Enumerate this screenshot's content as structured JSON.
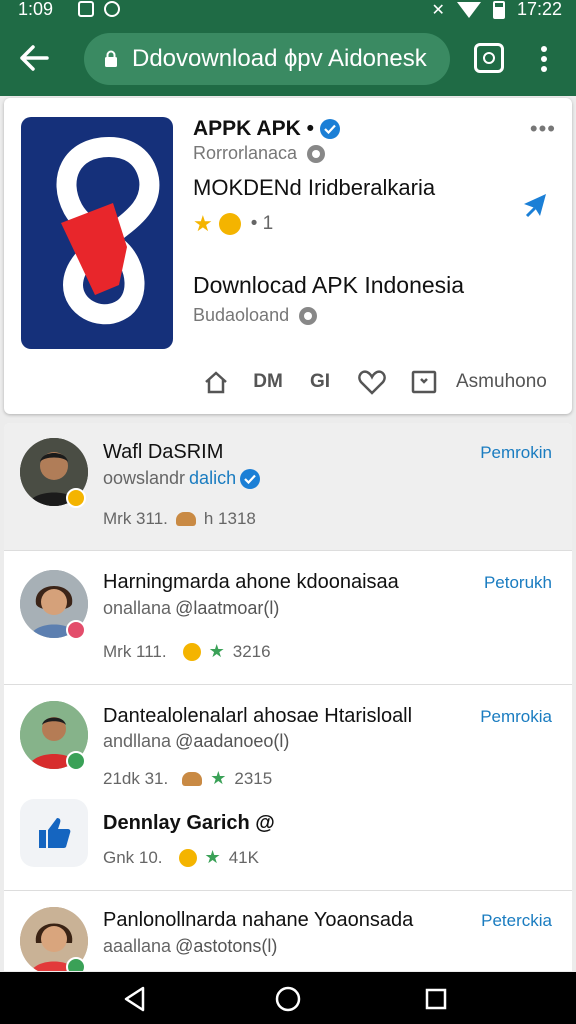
{
  "status_bar": {
    "time_left": "1:09",
    "time_right": "17:22"
  },
  "browser": {
    "url": "Ddovownload ɸpv Aidonesk"
  },
  "app_card": {
    "title": "APPK APK •",
    "subtitle": "Rorrorlanaca",
    "heading": "MOKDENd Iridberalkaria",
    "rating_text": "• 1",
    "heading2": "Downlocad APK Indonesia",
    "subtitle2": "Budaoloand",
    "actions": [
      "DM",
      "GI"
    ],
    "action_label": "Asmuhono"
  },
  "list_items": [
    {
      "title": "Wafl DaSRIM",
      "handle_plain": "oowslandr",
      "handle_link": "dalich",
      "stats_left": "Mrk 311.",
      "stats_right": "h 1318",
      "action": "Pemrokin"
    },
    {
      "title": "Harningmarda ahone kdoonaisaa",
      "handle_plain": "onallana",
      "handle_link": "@laatmoar(l)",
      "stats_left": "Mrk 111.",
      "stats_right": "3216",
      "action": "Petorukh"
    },
    {
      "title": "Dantealolenalarl ahosae Htarisloall",
      "handle_plain": "andllana",
      "handle_link": "@aadanoeo(l)",
      "stats_left": "21dk 31.",
      "stats_right": "2315",
      "action": "Pemrokia"
    },
    {
      "title": "Dennlay Garich @",
      "stats_left": "Gnk 10.",
      "stats_right": "41K"
    },
    {
      "title": "Panlonollnarda nahane Yoaonsada",
      "handle_plain": "aaallana",
      "handle_link": "@astotons(l)",
      "action": "Peterckia"
    }
  ]
}
